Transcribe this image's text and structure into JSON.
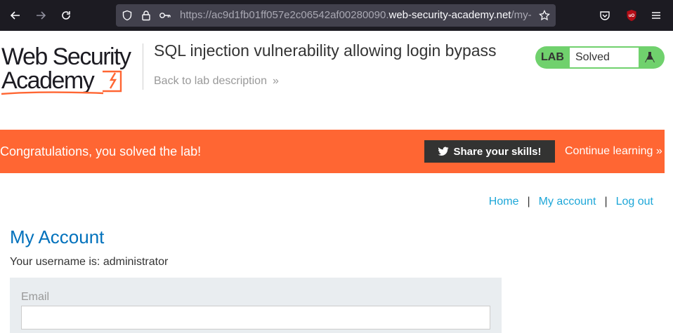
{
  "browser": {
    "url_dim_prefix": "https://ac9d1fb01ff057e2c06542af00280090.",
    "url_host": "web-security-academy.net",
    "url_dim_suffix": "/my-a"
  },
  "header": {
    "logo_line1": "Web Security",
    "logo_line2": "Academy",
    "lab_title": "SQL injection vulnerability allowing login bypass",
    "back_link": "Back to lab description",
    "lab_badge_label": "LAB",
    "lab_badge_state": "Solved"
  },
  "banner": {
    "message": "Congratulations, you solved the lab!",
    "share_label": "Share your skills!",
    "continue_label": "Continue learning"
  },
  "nav": {
    "home": "Home",
    "separator": "|",
    "my_account": "My account",
    "log_out": "Log out"
  },
  "account": {
    "title": "My Account",
    "username_text": "Your username is: administrator",
    "email_label": "Email",
    "email_value": ""
  },
  "colors": {
    "banner": "#ff6633",
    "lab_solved": "#70d16d",
    "link": "#1ea7d8",
    "heading": "#0071bc"
  }
}
